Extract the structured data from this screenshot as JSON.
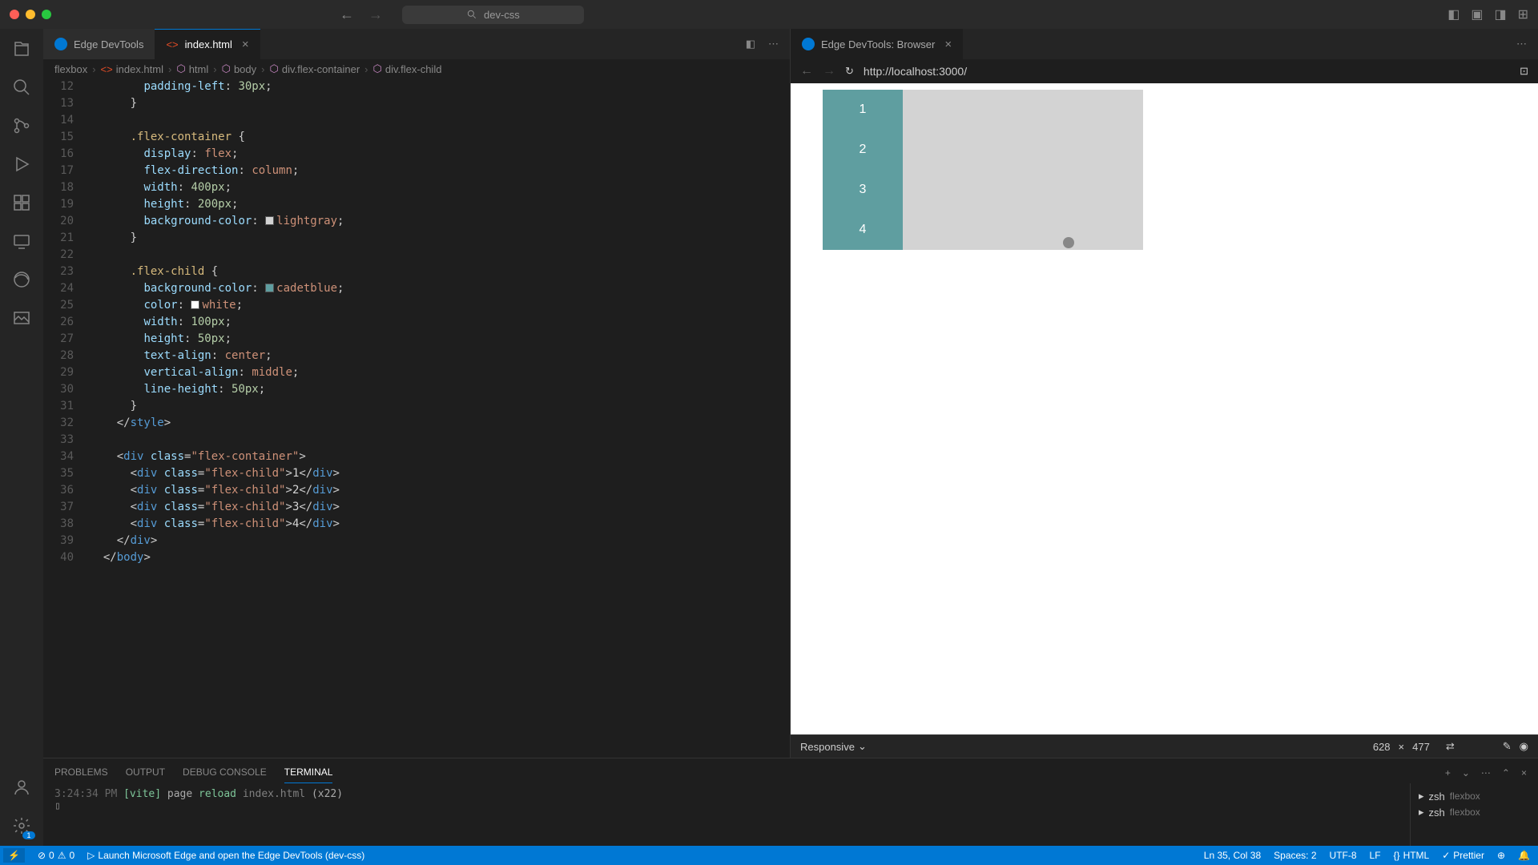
{
  "window": {
    "search": "dev-css"
  },
  "tabs": {
    "t1": {
      "label": "Edge DevTools"
    },
    "t2": {
      "label": "index.html"
    },
    "t3": {
      "label": "Edge DevTools: Browser"
    }
  },
  "breadcrumb": {
    "b1": "flexbox",
    "b2": "index.html",
    "b3": "html",
    "b4": "body",
    "b5": "div.flex-container",
    "b6": "div.flex-child"
  },
  "preview": {
    "url": "http://localhost:3000/",
    "device": "Responsive",
    "w": "628",
    "h": "477",
    "child1": "1",
    "child2": "2",
    "child3": "3",
    "child4": "4"
  },
  "panel": {
    "problems": "PROBLEMS",
    "output": "OUTPUT",
    "debug": "DEBUG CONSOLE",
    "terminal": "TERMINAL",
    "time": "3:24:34 PM",
    "vite": "[vite]",
    "msg1": "page",
    "msg2": "reload",
    "file": "index.html",
    "count": "(x22)",
    "shell1": "zsh",
    "dir1": "flexbox",
    "shell2": "zsh",
    "dir2": "flexbox"
  },
  "statusbar": {
    "errors": "0",
    "warnings": "0",
    "launch": "Launch Microsoft Edge and open the Edge DevTools (dev-css)",
    "pos": "Ln 35, Col 38",
    "spaces": "Spaces: 2",
    "enc": "UTF-8",
    "eol": "LF",
    "lang": "HTML",
    "prettier": "Prettier"
  },
  "activitybar": {
    "badge": "1"
  },
  "code": {
    "lines": [
      "12",
      "13",
      "14",
      "15",
      "16",
      "17",
      "18",
      "19",
      "20",
      "21",
      "22",
      "23",
      "24",
      "25",
      "26",
      "27",
      "28",
      "29",
      "30",
      "31",
      "32",
      "33",
      "34",
      "35",
      "36",
      "37",
      "38",
      "39",
      "40"
    ]
  }
}
